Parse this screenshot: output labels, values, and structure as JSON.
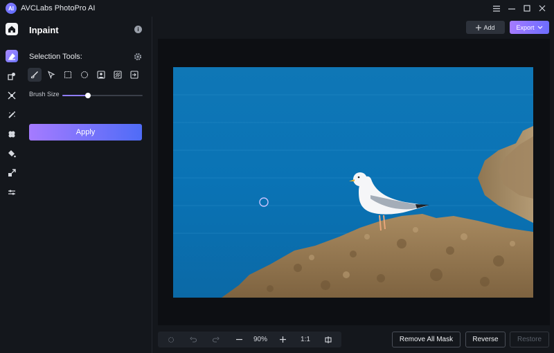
{
  "app": {
    "title": "AVCLabs PhotoPro AI",
    "logo_text": "AI"
  },
  "window_controls": [
    "menu-icon",
    "minimize-icon",
    "maximize-icon",
    "close-icon"
  ],
  "rail": [
    "home-icon",
    "inpaint-icon",
    "remove-object-icon",
    "upscale-icon",
    "colorize-icon",
    "denoise-icon",
    "fill-icon",
    "expand-icon",
    "adjust-icon"
  ],
  "panel": {
    "title": "Inpaint",
    "info_icon": "i",
    "selection_tools_label": "Selection Tools:",
    "tools": [
      "brush-icon",
      "lasso-icon",
      "rectangle-icon",
      "ellipse-icon",
      "portrait-select-icon",
      "pattern-select-icon",
      "import-mask-icon"
    ],
    "active_tool": 0,
    "brush_size_label": "Brush Size",
    "brush_size_value": 0.32,
    "apply_label": "Apply"
  },
  "topbar": {
    "add_label": "Add",
    "export_label": "Export"
  },
  "zoombar": {
    "zoom_level": "90%",
    "one_to_one": "1:1"
  },
  "actions": {
    "remove_all_mask": "Remove All Mask",
    "reverse": "Reverse",
    "restore": "Restore"
  },
  "colors": {
    "accent": "#8f7dff",
    "accent_gradient_end": "#4f6cf7",
    "background": "#14171c",
    "canvas": "#0d0f13"
  }
}
